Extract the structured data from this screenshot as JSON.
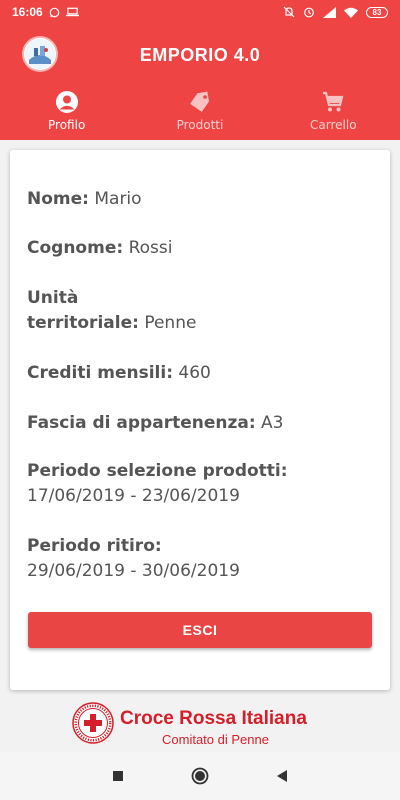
{
  "status_bar": {
    "time": "16:06",
    "battery": "83",
    "left_icons": [
      "whatsapp-icon",
      "laptop-icon"
    ],
    "right_icons": [
      "mute-icon",
      "alarm-icon",
      "signal-icon",
      "wifi-icon",
      "battery-icon"
    ]
  },
  "app": {
    "title": "EMPORIO 4.0",
    "accent_color": "#ee4444"
  },
  "tabs": [
    {
      "label": "Profilo",
      "icon": "person-icon",
      "active": true
    },
    {
      "label": "Prodotti",
      "icon": "tag-icon",
      "active": false
    },
    {
      "label": "Carrello",
      "icon": "cart-icon",
      "active": false
    }
  ],
  "profile": {
    "nome": {
      "label": "Nome:",
      "value": "Mario"
    },
    "cognome": {
      "label": "Cognome:",
      "value": "Rossi"
    },
    "unita": {
      "label_line1": "Unità",
      "label_line2": "territoriale:",
      "value": "Penne"
    },
    "crediti": {
      "label": "Crediti mensili:",
      "value": "460"
    },
    "fascia": {
      "label": "Fascia di appartenenza:",
      "value": "A3"
    },
    "periodo_selezione": {
      "label": "Periodo selezione prodotti:",
      "value": "17/06/2019 - 23/06/2019"
    },
    "periodo_ritiro": {
      "label": "Periodo ritiro:",
      "value": "29/06/2019 - 30/06/2019"
    }
  },
  "actions": {
    "esci_label": "ESCI"
  },
  "footer": {
    "org_name": "Croce Rossa Italiana",
    "committee": "Comitato di Penne"
  },
  "nav": {
    "icons": [
      "recents-icon",
      "home-icon",
      "back-icon"
    ]
  }
}
